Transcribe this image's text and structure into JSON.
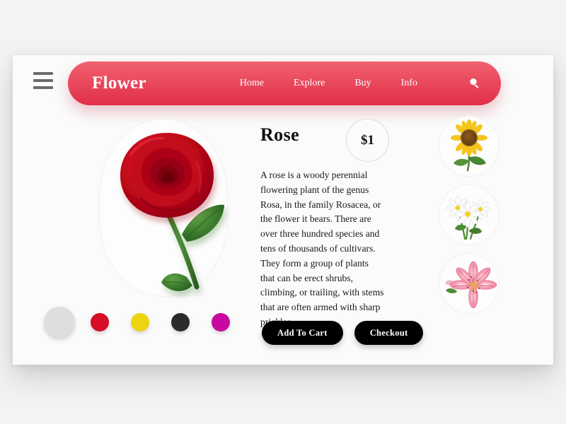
{
  "header": {
    "menu_icon": "hamburger-icon",
    "brand": "Flower",
    "nav": [
      {
        "label": "Home"
      },
      {
        "label": "Explore"
      },
      {
        "label": "Buy"
      },
      {
        "label": "Info"
      }
    ],
    "search_icon": "search-icon",
    "bar_gradient_top": "#f0626f",
    "bar_gradient_bottom": "#e12f49"
  },
  "product": {
    "name": "Rose",
    "price": "$1",
    "description": "A rose is a woody perennial flowering plant of the genus Rosa, in the family Rosacea, or the flower it bears. There are over three hundred species and tens of thousands of cultivars. They form a group of plants that can be erect shrubs, climbing, or trailing, with stems that are often armed with sharp prickles.",
    "hero_image": "red-rose",
    "buttons": {
      "add_to_cart": "Add To Cart",
      "checkout": "Checkout"
    }
  },
  "swatches": [
    {
      "name": "white",
      "color": "#dedede",
      "size": "lg",
      "selected": true
    },
    {
      "name": "red",
      "color": "#d50d26",
      "size": "sm",
      "selected": false
    },
    {
      "name": "yellow",
      "color": "#ecd412",
      "size": "sm",
      "selected": false
    },
    {
      "name": "charcoal",
      "color": "#2b2b2b",
      "size": "sm",
      "selected": false
    },
    {
      "name": "magenta",
      "color": "#c8089e",
      "size": "sm",
      "selected": false
    }
  ],
  "thumbnails": [
    {
      "name": "sunflower"
    },
    {
      "name": "daisy"
    },
    {
      "name": "lily"
    }
  ]
}
